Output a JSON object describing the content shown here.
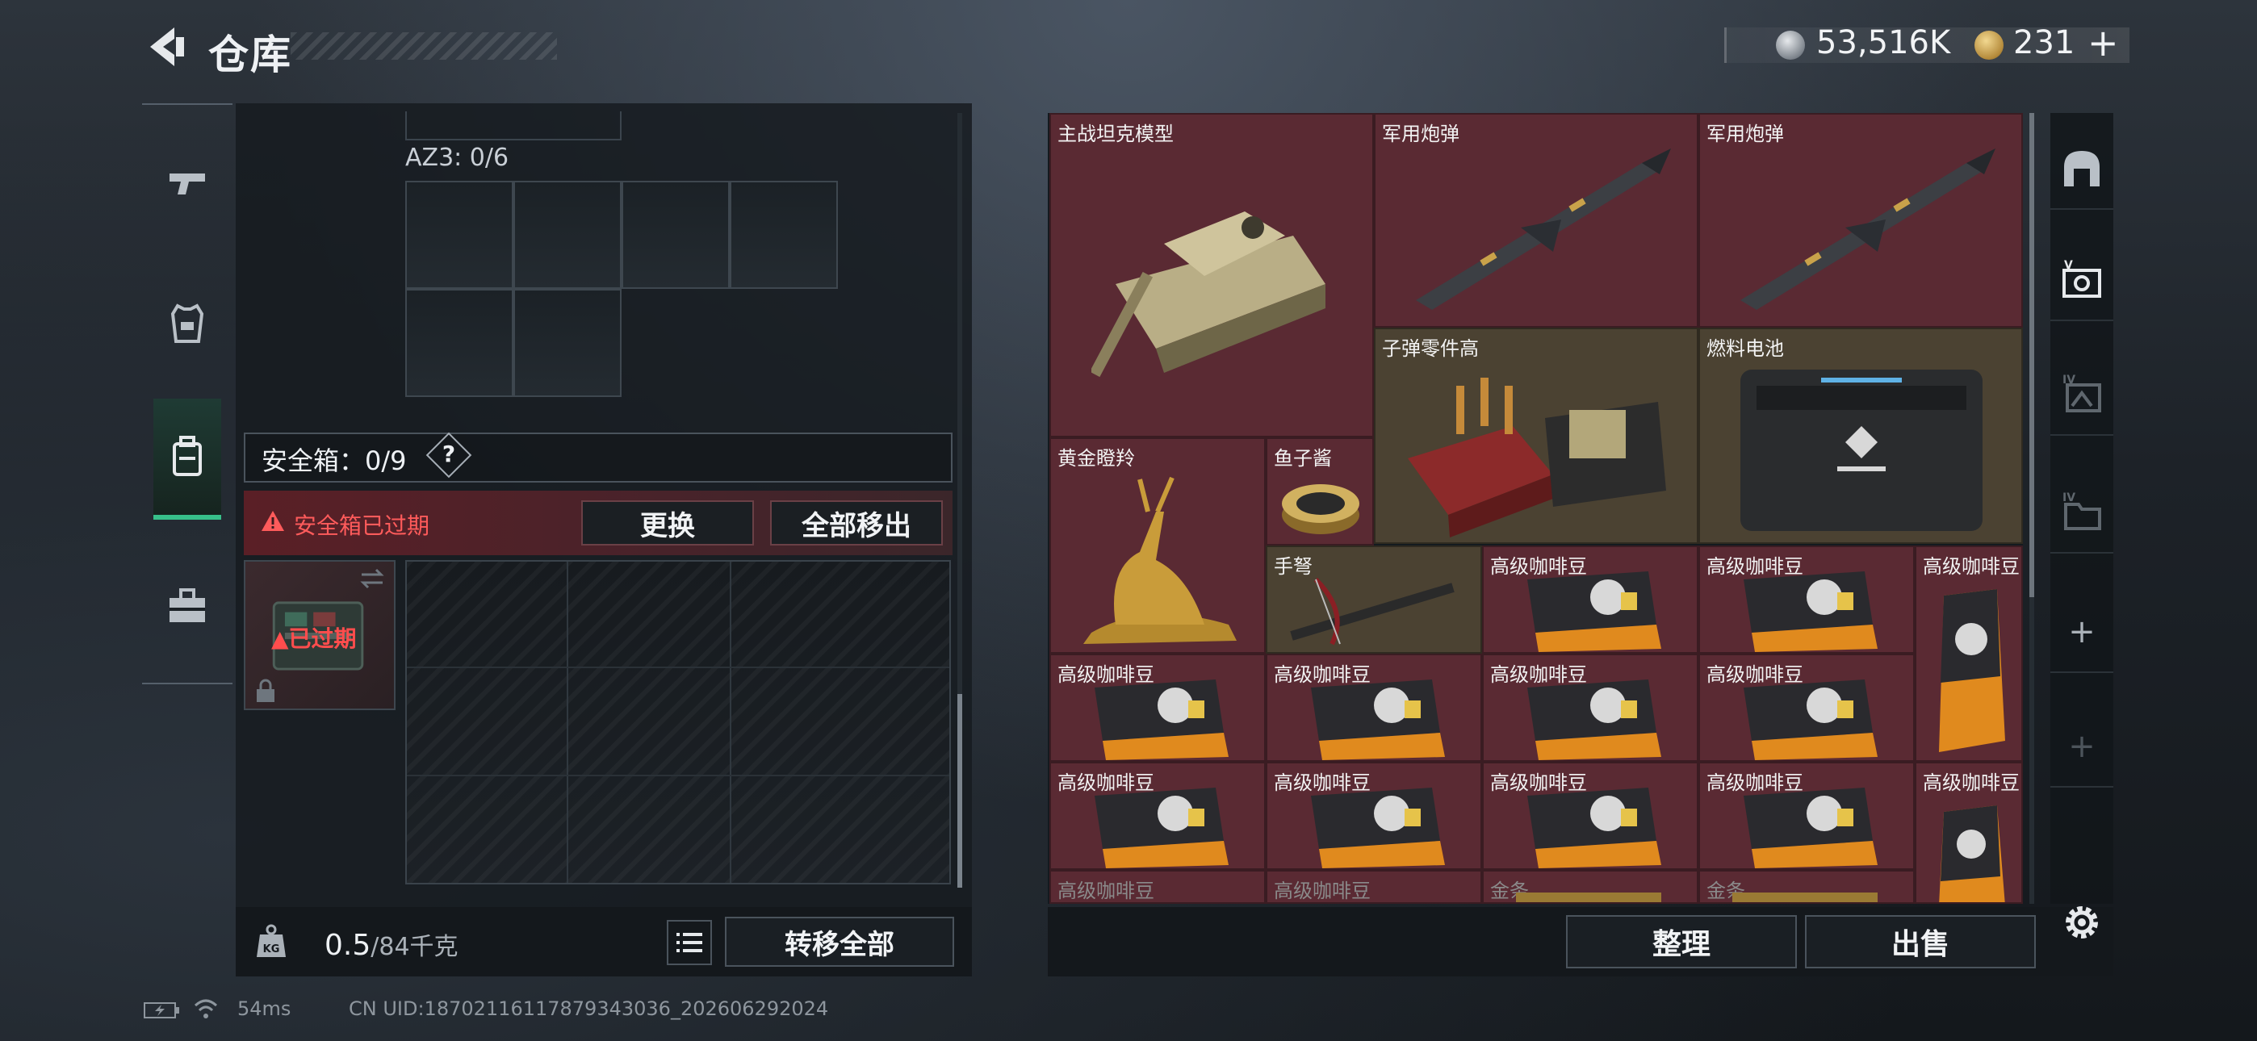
{
  "header": {
    "title": "仓库",
    "silver_amount": "53,516K",
    "gold_amount": "231",
    "plus": "+"
  },
  "left_tabs": [
    {
      "name": "weapons",
      "icon": "pistol-icon",
      "active": false
    },
    {
      "name": "equipment",
      "icon": "vest-icon",
      "active": false
    },
    {
      "name": "backpack",
      "icon": "backpack-icon",
      "active": true
    },
    {
      "name": "supplies",
      "icon": "toolbox-icon",
      "active": false
    }
  ],
  "left_panel": {
    "az3_label": "AZ3: 0/6",
    "safe_box_label": "安全箱：0/9",
    "help": "?",
    "expired_notice": "安全箱已过期",
    "replace_button": "更换",
    "move_all_out_button": "全部移出",
    "safe_thumb_status": "已过期",
    "weight_value": "0.5",
    "weight_unit": "/84千克",
    "transfer_all_button": "转移全部"
  },
  "inventory": [
    {
      "label": "主战坦克模型",
      "art": "tank"
    },
    {
      "label": "军用炮弹",
      "art": "missile"
    },
    {
      "label": "军用炮弹",
      "art": "missile"
    },
    {
      "label": "子弹零件高",
      "art": "ammo-parts"
    },
    {
      "label": "燃料电池",
      "art": "fuel-cell"
    },
    {
      "label": "黄金瞪羚",
      "art": "golden-gazelle"
    },
    {
      "label": "鱼子酱",
      "art": "caviar"
    },
    {
      "label": "手弩",
      "art": "crossbow"
    },
    {
      "label": "高级咖啡豆",
      "art": "coffee-bag"
    },
    {
      "label": "高级咖啡豆",
      "art": "coffee-bag"
    },
    {
      "label": "高级咖啡豆",
      "art": "coffee-bag-tall"
    },
    {
      "label": "高级咖啡豆",
      "art": "coffee-bag"
    },
    {
      "label": "高级咖啡豆",
      "art": "coffee-bag"
    },
    {
      "label": "高级咖啡豆",
      "art": "coffee-bag"
    },
    {
      "label": "高级咖啡豆",
      "art": "coffee-bag"
    },
    {
      "label": "高级咖啡豆",
      "art": "coffee-bag"
    },
    {
      "label": "高级咖啡豆",
      "art": "coffee-bag"
    },
    {
      "label": "高级咖啡豆",
      "art": "coffee-bag"
    },
    {
      "label": "高级咖啡豆",
      "art": "coffee-bag"
    },
    {
      "label": "高级咖啡豆",
      "art": "coffee-bag-tall"
    },
    {
      "label": "高级咖啡豆",
      "art": "coffee-bag"
    },
    {
      "label": "高级咖啡豆",
      "art": "coffee-bag"
    },
    {
      "label": "金条",
      "art": "gold-bar"
    },
    {
      "label": "金条",
      "art": "gold-bar"
    }
  ],
  "right_footer": {
    "sort_button": "整理",
    "sell_button": "出售"
  },
  "right_tabs": [
    {
      "icon": "vault-icon"
    },
    {
      "icon": "storage-v-icon"
    },
    {
      "icon": "storage-iv-icon"
    },
    {
      "icon": "storage-iv-folder-icon"
    },
    {
      "icon": "plus-icon",
      "text": "+"
    },
    {
      "icon": "plus-icon",
      "text": "+"
    }
  ],
  "status_bar": {
    "ping": "54ms",
    "uid": "CN UID:18702116117879343036_202606292024"
  },
  "colors": {
    "accent_green": "#37c08a",
    "item_red": "#5a2a33",
    "item_olive": "#4b4232",
    "warning_red": "#ff5b5b"
  }
}
